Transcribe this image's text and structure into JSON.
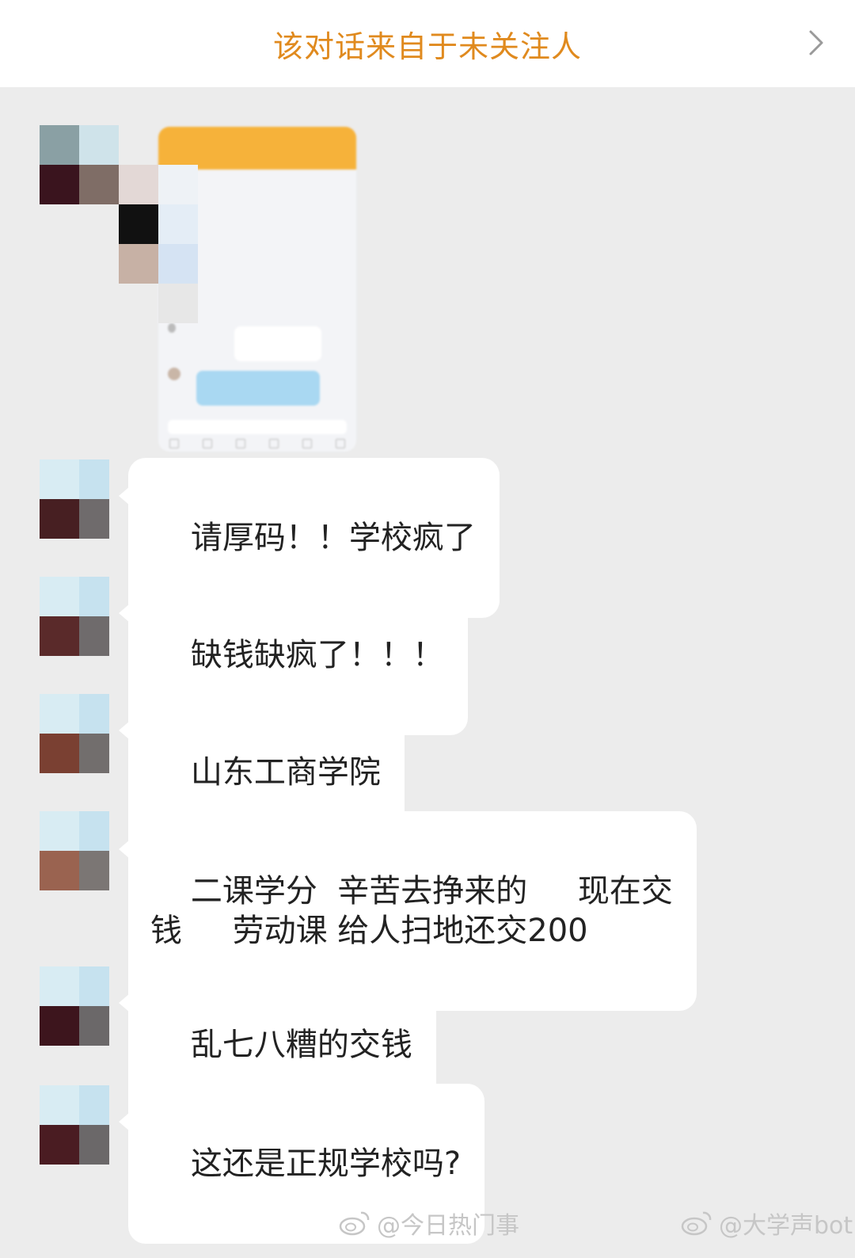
{
  "header": {
    "title": "该对话来自于未关注人",
    "chevron_icon": "chevron-right-icon"
  },
  "messages": [
    {
      "type": "image",
      "sender": "other"
    },
    {
      "type": "text",
      "sender": "other",
      "text": "请厚码！！学校疯了"
    },
    {
      "type": "text",
      "sender": "other",
      "text": "缺钱缺疯了！！！"
    },
    {
      "type": "text",
      "sender": "other",
      "text": "山东工商学院"
    },
    {
      "type": "text",
      "sender": "other",
      "text": "二课学分  辛苦去挣来的     现在交\n钱     劳动课 给人扫地还交200"
    },
    {
      "type": "text",
      "sender": "other",
      "text": "乱七八糟的交钱"
    },
    {
      "type": "text",
      "sender": "other",
      "text": "这还是正规学校吗?"
    }
  ],
  "watermarks": [
    {
      "icon": "weibo-icon",
      "text": "@今日热门事"
    },
    {
      "icon": "weibo-icon",
      "text": "@大学声bot"
    }
  ],
  "colors": {
    "header_title": "#e08a1e",
    "background": "#ececec",
    "bubble": "#ffffff"
  }
}
